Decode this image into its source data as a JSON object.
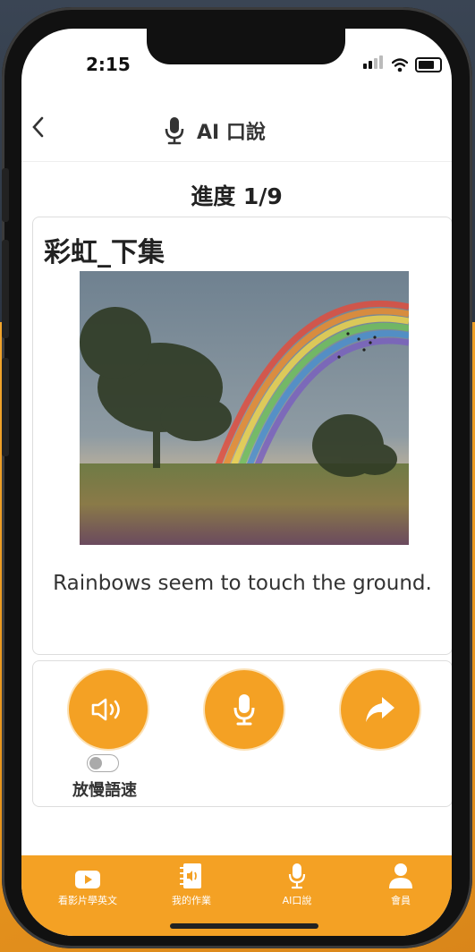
{
  "status_bar": {
    "time": "2:15"
  },
  "header": {
    "title": "AI 口說",
    "back_icon": "chevron-left-icon",
    "mic_icon": "microphone-icon"
  },
  "progress": {
    "label": "進度 1/9",
    "current": 1,
    "total": 9
  },
  "lesson": {
    "title": "彩虹_下集",
    "image": "rainbow-over-meadow-photo",
    "sentence": "Rainbows seem to touch the ground."
  },
  "controls": {
    "play_icon": "speaker-icon",
    "record_icon": "microphone-icon",
    "next_icon": "share-arrow-icon",
    "slow_speed_label": "放慢語速",
    "slow_speed_on": false
  },
  "tabbar": {
    "items": [
      {
        "label": "看影片學英文",
        "icon": "video-play-icon"
      },
      {
        "label": "我的作業",
        "icon": "homework-icon"
      },
      {
        "label": "AI口說",
        "icon": "microphone-icon"
      },
      {
        "label": "會員",
        "icon": "user-icon"
      }
    ]
  },
  "colors": {
    "accent": "#f4a124",
    "text": "#333333",
    "border": "#dddddd"
  }
}
